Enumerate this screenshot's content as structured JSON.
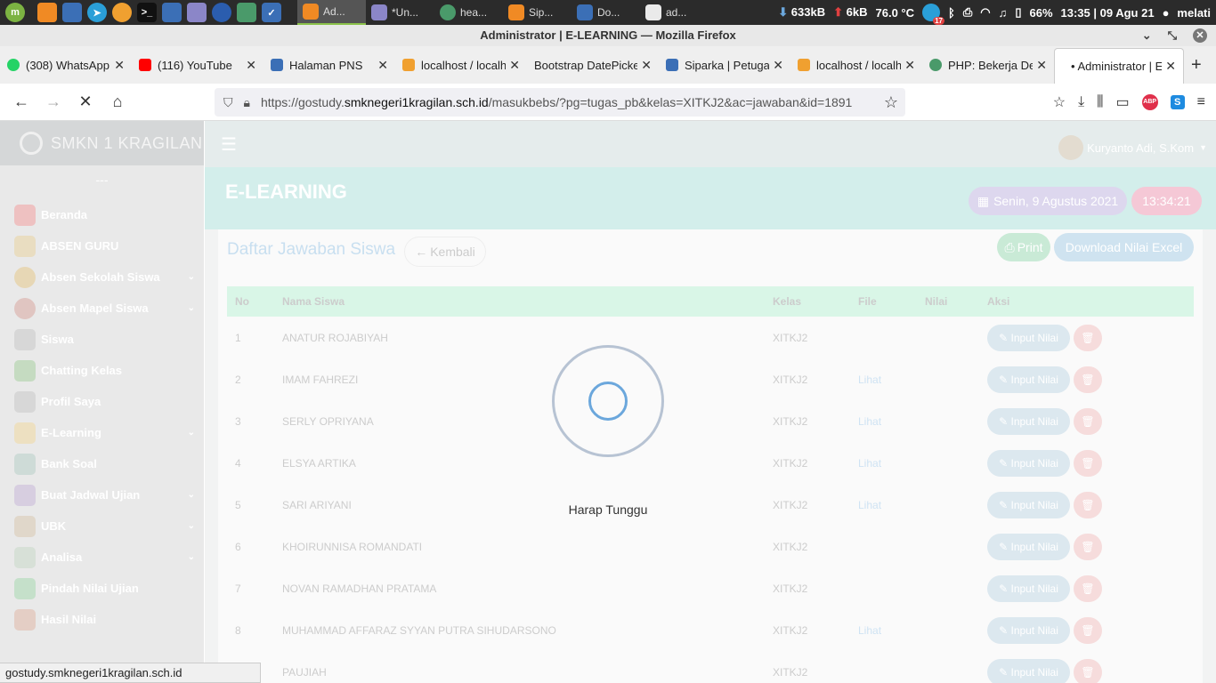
{
  "system": {
    "tasks": [
      "Ad...",
      "*Un...",
      "hea...",
      "Sip...",
      "Do...",
      "ad..."
    ],
    "net_down": "633kB",
    "net_up": "6kB",
    "temp": "76.0 °C",
    "badge": "17",
    "battery": "66%",
    "clock": "13:35 | 09 Agu 21",
    "user": "melati"
  },
  "window": {
    "title": "Administrator | E-LEARNING — Mozilla Firefox"
  },
  "tabs": [
    {
      "label": "(308) WhatsApp",
      "color": "#25d366"
    },
    {
      "label": "(116) YouTube",
      "color": "#ff0000"
    },
    {
      "label": "Halaman PNS",
      "color": "#3b6fb6"
    },
    {
      "label": "localhost / localhost",
      "color": "#f0a030"
    },
    {
      "label": "Bootstrap DatePicker",
      "color": "#ffffff"
    },
    {
      "label": "Siparka | Petugas",
      "color": "#3b6fb6"
    },
    {
      "label": "localhost / localhost",
      "color": "#f0a030"
    },
    {
      "label": "PHP: Bekerja Dengan",
      "color": "#4a9a6a"
    },
    {
      "label": "• Administrator | E",
      "color": "#ffffff"
    }
  ],
  "url": {
    "prefix": "https://gostudy.",
    "host": "smknegeri1kragilan.sch.id",
    "path": "/masukbebs/?pg=tugas_pb&kelas=XITKJ2&ac=jawaban&id=1891"
  },
  "sidebar": {
    "brand": "SMKN 1 KRAGILAN",
    "dash": "---",
    "items": [
      {
        "label": "Beranda",
        "chevron": ""
      },
      {
        "label": "ABSEN GURU",
        "chevron": ""
      },
      {
        "label": "Absen Sekolah Siswa",
        "chevron": "⌄"
      },
      {
        "label": "Absen Mapel Siswa",
        "chevron": "⌄"
      },
      {
        "label": "Siswa",
        "chevron": ""
      },
      {
        "label": "Chatting Kelas",
        "chevron": ""
      },
      {
        "label": "Profil Saya",
        "chevron": ""
      },
      {
        "label": "E-Learning",
        "chevron": "⌄"
      },
      {
        "label": "Bank Soal",
        "chevron": ""
      },
      {
        "label": "Buat Jadwal Ujian",
        "chevron": "⌄"
      },
      {
        "label": "UBK",
        "chevron": "⌄"
      },
      {
        "label": "Analisa",
        "chevron": "⌄"
      },
      {
        "label": "Pindah Nilai Ujian",
        "chevron": ""
      },
      {
        "label": "Hasil Nilai",
        "chevron": ""
      }
    ]
  },
  "header": {
    "user": "Kuryanto Adi, S.Kom",
    "menu_icon": "hamburger-icon"
  },
  "hero": {
    "title": "E-LEARNING",
    "date": "Senin, 9 Agustus 2021",
    "time": "13:34:21"
  },
  "card": {
    "title": "Daftar Jawaban Siswa",
    "back": "Kembali",
    "print": "Print",
    "download": "Download Nilai Excel",
    "columns": [
      "No",
      "Nama Siswa",
      "Kelas",
      "File",
      "Nilai",
      "Aksi"
    ],
    "input_label": "Input Nilai",
    "rows": [
      {
        "no": "1",
        "name": "ANATUR ROJABIYAH",
        "kelas": "XITKJ2",
        "file": "",
        "nilai": ""
      },
      {
        "no": "2",
        "name": "IMAM FAHREZI",
        "kelas": "XITKJ2",
        "file": "Lihat",
        "nilai": ""
      },
      {
        "no": "3",
        "name": "SERLY OPRIYANA",
        "kelas": "XITKJ2",
        "file": "Lihat",
        "nilai": ""
      },
      {
        "no": "4",
        "name": "ELSYA ARTIKA",
        "kelas": "XITKJ2",
        "file": "Lihat",
        "nilai": ""
      },
      {
        "no": "5",
        "name": "SARI ARIYANI",
        "kelas": "XITKJ2",
        "file": "Lihat",
        "nilai": ""
      },
      {
        "no": "6",
        "name": "KHOIRUNNISA ROMANDATI",
        "kelas": "XITKJ2",
        "file": "",
        "nilai": ""
      },
      {
        "no": "7",
        "name": "NOVAN RAMADHAN PRATAMA",
        "kelas": "XITKJ2",
        "file": "",
        "nilai": ""
      },
      {
        "no": "8",
        "name": "MUHAMMAD AFFARAZ SYYAN PUTRA SIHUDARSONO",
        "kelas": "XITKJ2",
        "file": "Lihat",
        "nilai": ""
      },
      {
        "no": "",
        "name": "PAUJIAH",
        "kelas": "XITKJ2",
        "file": "",
        "nilai": ""
      }
    ]
  },
  "loading": {
    "text": "Harap Tunggu"
  },
  "statusbar": "gostudy.smknegeri1kragilan.sch.id"
}
